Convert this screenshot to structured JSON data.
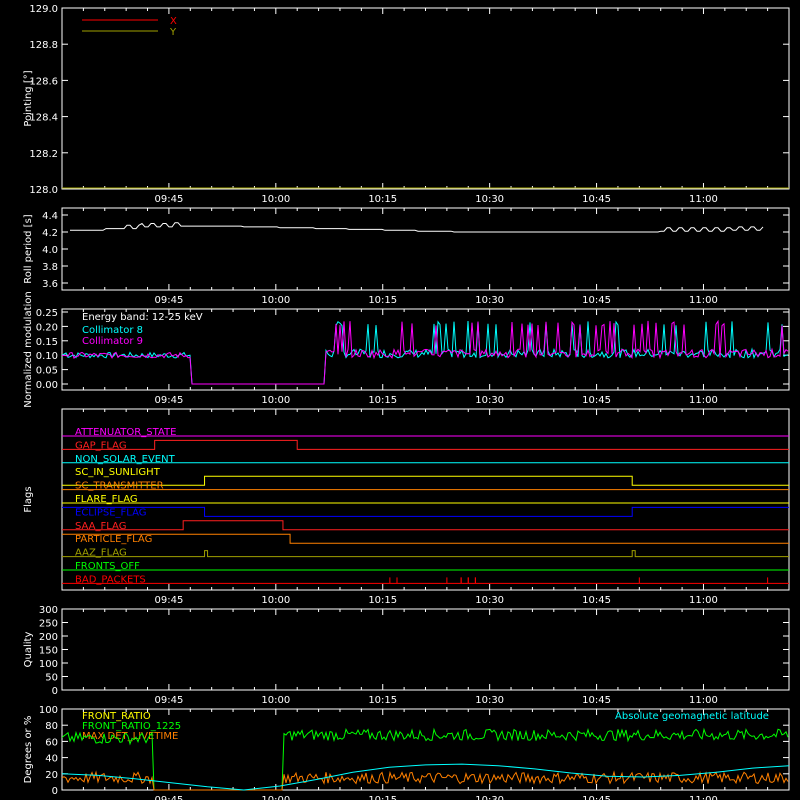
{
  "time_ticks": [
    "09:45",
    "10:00",
    "10:15",
    "10:30",
    "10:45",
    "11:00"
  ],
  "chart_data": [
    {
      "type": "line",
      "ylabel": "Pointing [°]",
      "ylim": [
        128.0,
        129.0
      ],
      "yticks": [
        "129.0",
        "128.8",
        "128.6",
        "128.4",
        "128.2",
        "128.0"
      ],
      "legend": [
        {
          "name": "X",
          "color": "#ff0000"
        },
        {
          "name": "Y",
          "color": "#a0a000"
        }
      ],
      "series": []
    },
    {
      "type": "line",
      "ylabel": "Roll period [s]",
      "ylim": [
        3.5,
        4.5
      ],
      "yticks": [
        "4.4",
        "4.2",
        "4.0",
        "3.8",
        "3.6"
      ],
      "series": [
        {
          "color": "#ffffff",
          "values": [
            4.22,
            4.24,
            4.26,
            4.27,
            4.27,
            4.26,
            4.25,
            4.24,
            4.23,
            4.22,
            4.21,
            4.2,
            4.2,
            4.2,
            4.2,
            4.2,
            4.2,
            4.21,
            4.21,
            4.22
          ]
        }
      ]
    },
    {
      "type": "line",
      "ylabel": "Normalized modulation",
      "ylim": [
        -0.02,
        0.26
      ],
      "yticks": [
        "0.25",
        "0.20",
        "0.15",
        "0.10",
        "0.05",
        "0.00"
      ],
      "annotations": [
        "Energy band: 12-25 keV"
      ],
      "legend": [
        {
          "name": "Collimator 8",
          "color": "#00ffff"
        },
        {
          "name": "Collimator 9",
          "color": "#ff00ff"
        }
      ],
      "gap": [
        "09:48",
        "10:07"
      ]
    },
    {
      "type": "line",
      "ylabel": "Flags",
      "flags": [
        {
          "name": "ATTENUATOR_STATE",
          "color": "#ff00ff"
        },
        {
          "name": "GAP_FLAG",
          "color": "#ff2020"
        },
        {
          "name": "NON_SOLAR_EVENT",
          "color": "#00ffff"
        },
        {
          "name": "SC_IN_SUNLIGHT",
          "color": "#ffff00"
        },
        {
          "name": "SC_TRANSMITTER",
          "color": "#ff8000"
        },
        {
          "name": "FLARE_FLAG",
          "color": "#ffff00"
        },
        {
          "name": "ECLIPSE_FLAG",
          "color": "#0000ff"
        },
        {
          "name": "SAA_FLAG",
          "color": "#ff2020"
        },
        {
          "name": "PARTICLE_FLAG",
          "color": "#ff8000"
        },
        {
          "name": "AAZ_FLAG",
          "color": "#a0a000"
        },
        {
          "name": "FRONTS_OFF",
          "color": "#00ff00"
        },
        {
          "name": "BAD_PACKETS",
          "color": "#ff0000"
        }
      ],
      "bad_packet_times": [
        "10:16",
        "10:17",
        "10:24",
        "10:26",
        "10:26",
        "10:27",
        "10:27",
        "10:28",
        "10:28",
        "10:51",
        "11:09"
      ]
    },
    {
      "type": "line",
      "ylabel": "Quality",
      "ylim": [
        0,
        300
      ],
      "yticks": [
        "300",
        "250",
        "200",
        "150",
        "100",
        "50",
        "0"
      ],
      "series": []
    },
    {
      "type": "line",
      "ylabel": "Degrees or %",
      "ylim": [
        0,
        100
      ],
      "yticks": [
        "100",
        "80",
        "60",
        "40",
        "20",
        "0"
      ],
      "legend": [
        {
          "name": "FRONT_RATIO",
          "color": "#ffff00"
        },
        {
          "name": "FRONT_RATIO_1225",
          "color": "#00ff00"
        },
        {
          "name": "MAX DET_LIVETIME",
          "color": "#ff8000"
        }
      ],
      "annotation": {
        "text": "Absolute geomagnetic latitude",
        "color": "#00ffff"
      },
      "series": [
        {
          "name": "FRONT_RATIO_1225",
          "color": "#00ff00",
          "level": 68
        },
        {
          "name": "MAX DET_LIVETIME",
          "color": "#ff8000",
          "level": 15
        },
        {
          "name": "Absolute geomagnetic latitude",
          "color": "#00ffff",
          "values": [
            20,
            18,
            14,
            9,
            4,
            0,
            5,
            13,
            22,
            28,
            31,
            32,
            30,
            26,
            21,
            17,
            16,
            18,
            22,
            27,
            30
          ]
        }
      ]
    }
  ]
}
